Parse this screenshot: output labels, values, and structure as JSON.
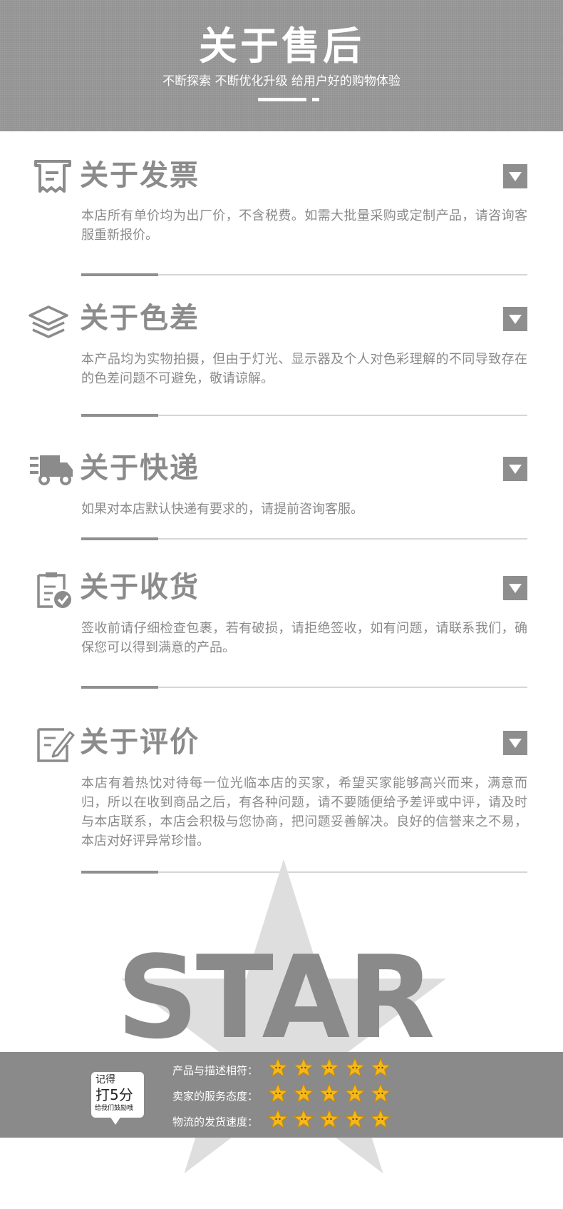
{
  "header": {
    "title": "关于售后",
    "subtitle": "不断探索 不断优化升级 给用户好的购物体验"
  },
  "sections": [
    {
      "icon": "receipt-icon",
      "title": "关于发票",
      "text": "本店所有单价均为出厂价，不含税费。如需大批量采购或定制产品，请咨询客服重新报价。"
    },
    {
      "icon": "layers-icon",
      "title": "关于色差",
      "text": "本产品均为实物拍摄，但由于灯光、显示器及个人对色彩理解的不同导致存在的色差问题不可避免，敬请谅解。"
    },
    {
      "icon": "delivery-truck-icon",
      "title": "关于快递",
      "text": "如果对本店默认快递有要求的，请提前咨询客服。"
    },
    {
      "icon": "clipboard-check-icon",
      "title": "关于收货",
      "text": "签收前请仔细检查包裹，若有破损，请拒绝签收，如有问题，请联系我们，确保您可以得到满意的产品。"
    },
    {
      "icon": "edit-note-icon",
      "title": "关于评价",
      "text": "本店有着热忱对待每一位光临本店的买家，希望买家能够高兴而来，满意而归，所以在收到商品之后，有各种问题，请不要随便给予差评或中评，请及时与本店联系，本店会积极与您协商，把问题妥善解决。良好的信誉来之不易，本店对好评异常珍惜。"
    }
  ],
  "brand": {
    "logo_text": "STAR"
  },
  "rating": {
    "bubble_line1": "记得",
    "bubble_line2": "打5分",
    "bubble_line3": "给我们鼓励哦",
    "rows": [
      {
        "label": "产品与描述相符：",
        "stars": 5
      },
      {
        "label": "卖家的服务态度：",
        "stars": 5
      },
      {
        "label": "物流的发货速度：",
        "stars": 5
      }
    ]
  },
  "colors": {
    "header_bg": "#939393",
    "accent_gray": "#8e8e8e",
    "star_gold": "#f5b81c"
  }
}
